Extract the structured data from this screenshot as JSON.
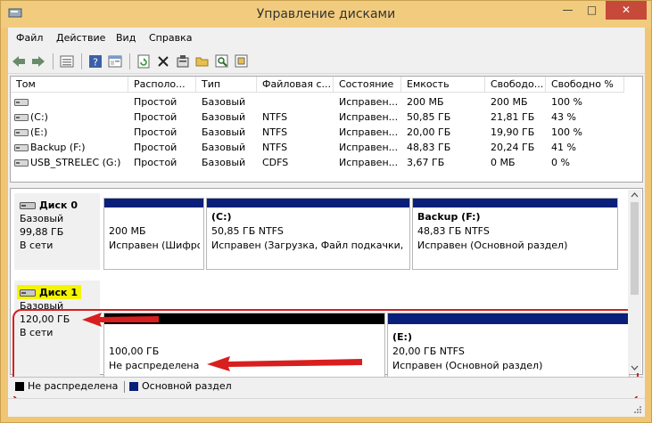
{
  "window": {
    "title": "Управление дисками",
    "minimize": "—",
    "maximize": "□",
    "close": "✕"
  },
  "menu": [
    "Файл",
    "Действие",
    "Вид",
    "Справка"
  ],
  "toolbar": {
    "buttons": [
      "back-arrow",
      "forward-arrow",
      "properties-list",
      "help-question",
      "help-pane",
      "refresh",
      "delete",
      "properties",
      "folder-open",
      "search",
      "settings"
    ]
  },
  "volumes": {
    "columns": [
      "Том",
      "Располо...",
      "Тип",
      "Файловая с...",
      "Состояние",
      "Емкость",
      "Свободо...",
      "Свободно %"
    ],
    "rows": [
      [
        "",
        "Простой",
        "Базовый",
        "",
        "Исправен...",
        "200 МБ",
        "200 МБ",
        "100 %"
      ],
      [
        "(C:)",
        "Простой",
        "Базовый",
        "NTFS",
        "Исправен...",
        "50,85 ГБ",
        "21,81 ГБ",
        "43 %"
      ],
      [
        "(E:)",
        "Простой",
        "Базовый",
        "NTFS",
        "Исправен...",
        "20,00 ГБ",
        "19,90 ГБ",
        "100 %"
      ],
      [
        "Backup (F:)",
        "Простой",
        "Базовый",
        "NTFS",
        "Исправен...",
        "48,83 ГБ",
        "20,24 ГБ",
        "41 %"
      ],
      [
        "USB_STRELEC (G:)",
        "Простой",
        "Базовый",
        "CDFS",
        "Исправен...",
        "3,67 ГБ",
        "0 МБ",
        "0 %"
      ]
    ]
  },
  "disks": [
    {
      "name": "Диск 0",
      "type": "Базовый",
      "size": "99,88 ГБ",
      "status": "В сети",
      "partitions": [
        {
          "title": "",
          "size": "200 МБ",
          "status": "Исправен (Шифро"
        },
        {
          "title": "(C:)",
          "size": "50,85 ГБ NTFS",
          "status": "Исправен (Загрузка, Файл подкачки, Ав"
        },
        {
          "title": "Backup  (F:)",
          "size": "48,83 ГБ NTFS",
          "status": "Исправен (Основной раздел)"
        }
      ]
    },
    {
      "name": "Диск 1",
      "type": "Базовый",
      "size": "120,00 ГБ",
      "status": "В сети",
      "partitions": [
        {
          "title": "",
          "size": "100,00 ГБ",
          "status": "Не распределена"
        },
        {
          "title": "(E:)",
          "size": "20,00 ГБ NTFS",
          "status": "Исправен (Основной раздел)"
        }
      ]
    }
  ],
  "legend": [
    {
      "label": "Не распределена",
      "color": "#000000"
    },
    {
      "label": "Основной раздел",
      "color": "#0a1f7a"
    }
  ],
  "colors": {
    "primary_bar": "#0a1f7a",
    "unallocated_bar": "#000000",
    "highlight": "#f5f500",
    "annotation": "#d81e1e"
  }
}
